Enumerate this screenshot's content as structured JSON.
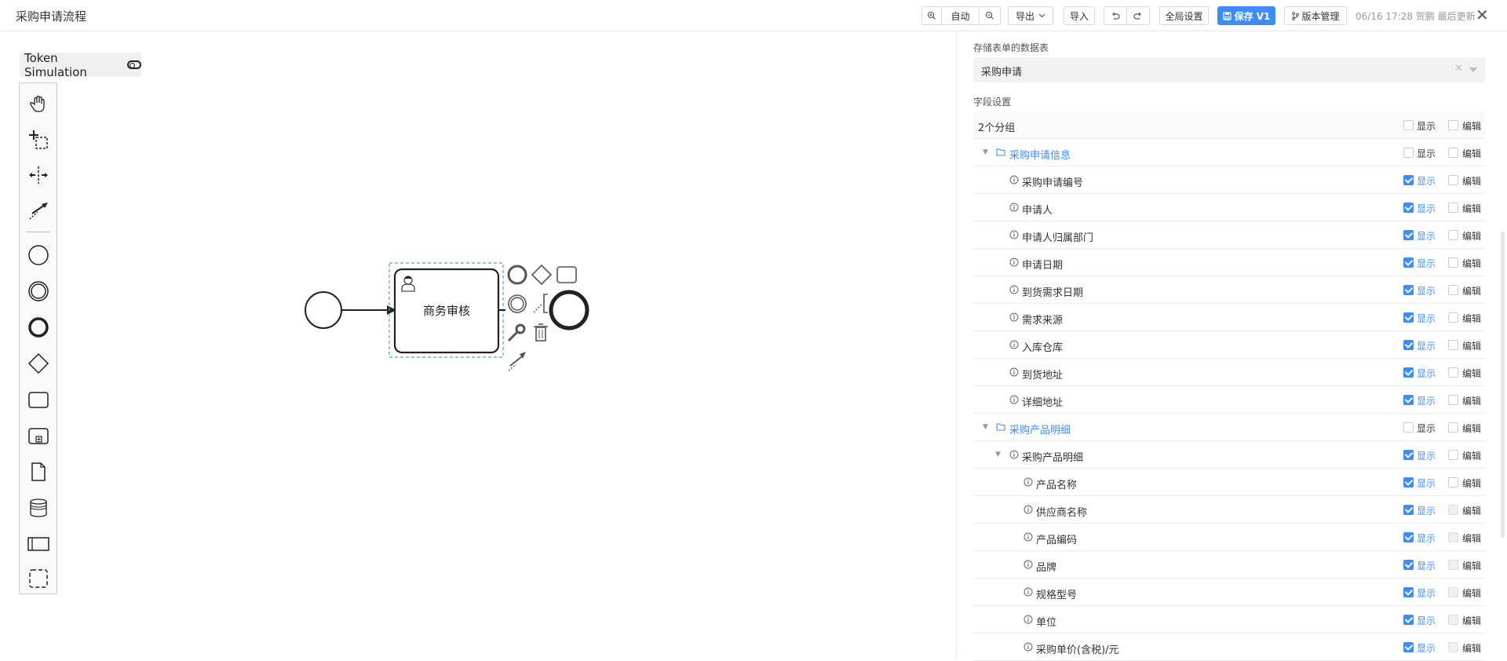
{
  "header": {
    "title": "采购申请流程",
    "zoom_label": "自动",
    "export_label": "导出",
    "import_label": "导入",
    "global_settings_label": "全局设置",
    "save_label": "保存 V1",
    "version_label": "版本管理",
    "updated_text": "06/16 17:28 贺鹏 最后更新",
    "close_symbol": "✕"
  },
  "canvas": {
    "token_simulation_label": "Token Simulation",
    "task_label": "商务审核",
    "palette_tools": [
      "hand-tool",
      "lasso-tool",
      "space-tool",
      "global-connect-tool",
      "start-event",
      "intermediate-event",
      "end-event",
      "gateway",
      "task",
      "subprocess",
      "data-object",
      "data-store",
      "pool",
      "group"
    ]
  },
  "panel": {
    "table_label": "存储表单的数据表",
    "table_value": "采购申请",
    "clear_symbol": "✕",
    "fields_label": "字段设置",
    "accent_color": "#3d8bfd",
    "show_label": "显示",
    "edit_label": "编辑",
    "summary": "2个分组",
    "rows": [
      {
        "text": "采购申请信息",
        "type": "group",
        "show": false,
        "edit": false
      },
      {
        "text": "采购申请编号",
        "type": "field",
        "show": true,
        "edit": false
      },
      {
        "text": "申请人",
        "type": "field",
        "show": true,
        "edit": false
      },
      {
        "text": "申请人归属部门",
        "type": "field",
        "show": true,
        "edit": false
      },
      {
        "text": "申请日期",
        "type": "field",
        "show": true,
        "edit": false
      },
      {
        "text": "到货需求日期",
        "type": "field",
        "show": true,
        "edit": false
      },
      {
        "text": "需求来源",
        "type": "field",
        "show": true,
        "edit": false
      },
      {
        "text": "入库仓库",
        "type": "field",
        "show": true,
        "edit": false
      },
      {
        "text": "到货地址",
        "type": "field",
        "show": true,
        "edit": false
      },
      {
        "text": "详细地址",
        "type": "field",
        "show": true,
        "edit": false
      },
      {
        "text": "采购产品明细",
        "type": "group",
        "show": false,
        "edit": false
      },
      {
        "text": "采购产品明细",
        "type": "subgroup",
        "show": true,
        "edit": false
      },
      {
        "text": "产品名称",
        "type": "subfield",
        "show": true,
        "edit": false
      },
      {
        "text": "供应商名称",
        "type": "subfield",
        "show": true,
        "edit": false,
        "disabled": true
      },
      {
        "text": "产品编码",
        "type": "subfield",
        "show": true,
        "edit": false,
        "disabled": true
      },
      {
        "text": "品牌",
        "type": "subfield",
        "show": true,
        "edit": false,
        "disabled": true
      },
      {
        "text": "规格型号",
        "type": "subfield",
        "show": true,
        "edit": false,
        "disabled": true
      },
      {
        "text": "单位",
        "type": "subfield",
        "show": true,
        "edit": false,
        "disabled": true
      },
      {
        "text": "采购单价(含税)/元",
        "type": "subfield",
        "show": true,
        "edit": false,
        "disabled": true
      }
    ]
  }
}
